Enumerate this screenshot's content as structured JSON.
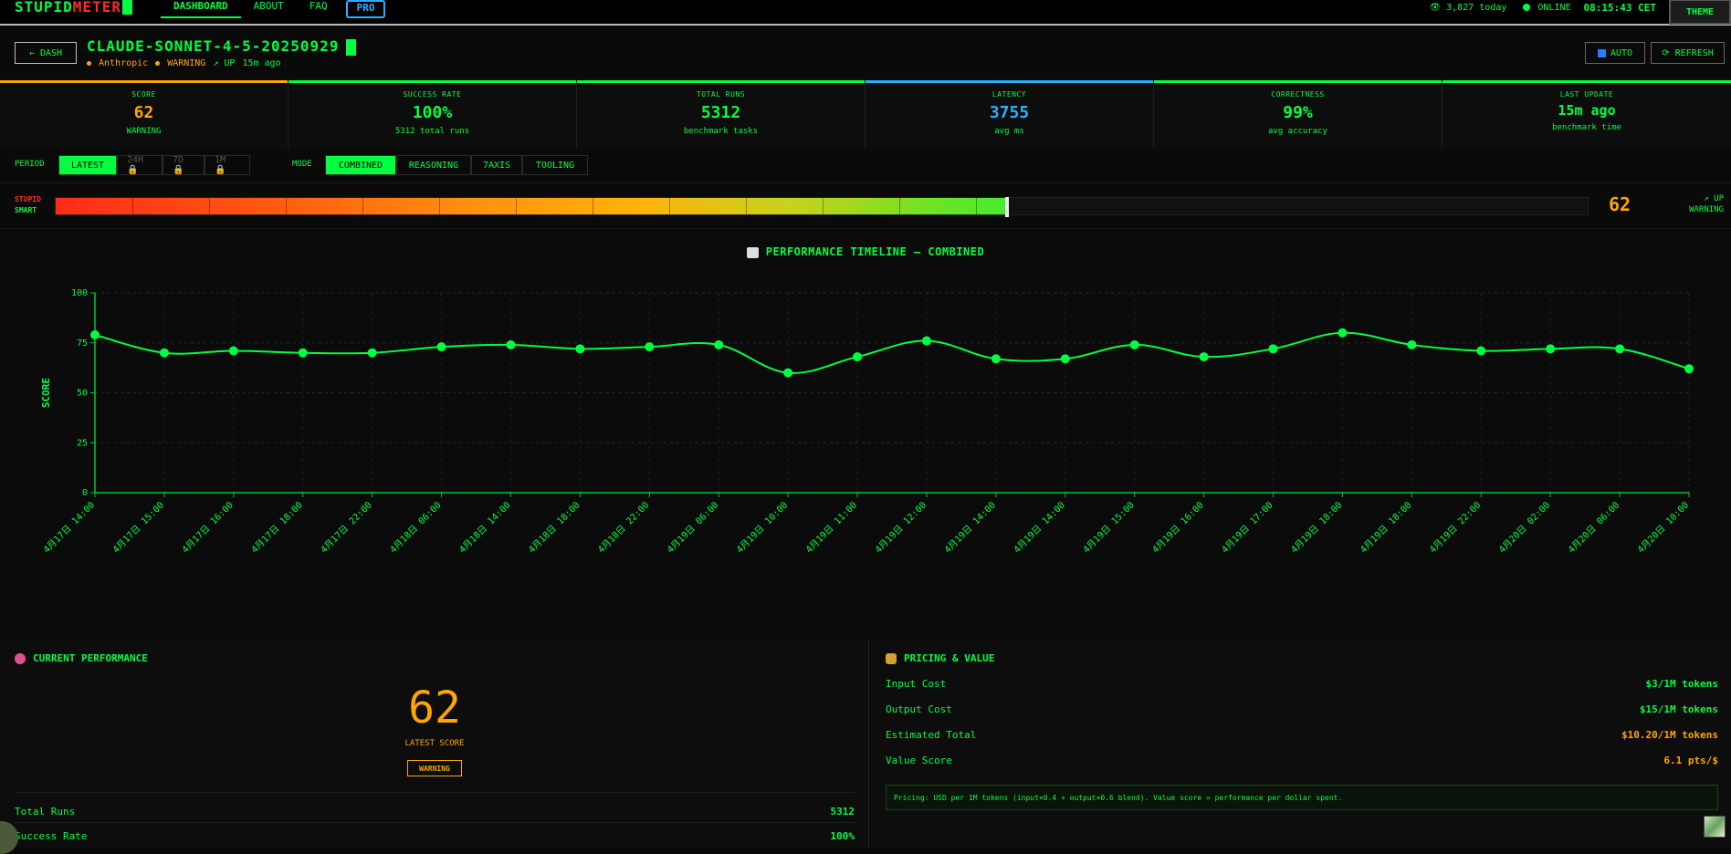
{
  "nav": {
    "logo_a": "STUPID",
    "logo_b": "METER",
    "links": [
      "DASHBOARD",
      "ABOUT",
      "FAQ"
    ],
    "pro": "PRO",
    "visitors": "3,827 today",
    "status": "ONLINE",
    "clock": "08:15:43 CET",
    "theme": "THEME"
  },
  "header": {
    "back": "← DASH",
    "model": "CLAUDE-SONNET-4-5-20250929",
    "provider": "Anthropic",
    "status": "WARNING",
    "trend": "↗ UP",
    "updated": "15m ago",
    "auto": "AUTO",
    "refresh": "⟳ REFRESH"
  },
  "stats": [
    {
      "label": "SCORE",
      "value": "62",
      "sub": "WARNING",
      "color": "#ffa500"
    },
    {
      "label": "SUCCESS RATE",
      "value": "100%",
      "sub": "5312 total runs",
      "color": "#00ff41"
    },
    {
      "label": "TOTAL RUNS",
      "value": "5312",
      "sub": "benchmark tasks",
      "color": "#00ff41"
    },
    {
      "label": "LATENCY",
      "value": "3755",
      "sub": "avg ms",
      "color": "#2ab0ff"
    },
    {
      "label": "CORRECTNESS",
      "value": "99%",
      "sub": "avg accuracy",
      "color": "#00ff41"
    },
    {
      "label": "LAST UPDATE",
      "value": "15m ago",
      "sub": "benchmark time",
      "color": "#00ff41"
    }
  ],
  "controls": {
    "period_label": "PERIOD",
    "periods": [
      "LATEST",
      "24H 🔒",
      "7D 🔒",
      "1M 🔒"
    ],
    "mode_label": "MODE",
    "modes": [
      "COMBINED",
      "REASONING",
      "7AXIS",
      "TOOLING"
    ]
  },
  "meter": {
    "label_low": "STUPID",
    "label_high": "SMART",
    "score": "62",
    "trend": "↗ UP",
    "status": "WARNING",
    "level": 0.62
  },
  "chart_title": "PERFORMANCE TIMELINE — COMBINED",
  "chart_data": {
    "type": "line",
    "ylabel": "SCORE",
    "ylim": [
      0,
      100
    ],
    "yticks": [
      0,
      25,
      50,
      75,
      100
    ],
    "grid": true,
    "categories": [
      "4月17日 14:00",
      "4月17日 15:00",
      "4月17日 16:00",
      "4月17日 18:00",
      "4月17日 22:00",
      "4月18日 06:00",
      "4月18日 14:00",
      "4月18日 18:00",
      "4月18日 22:00",
      "4月19日 06:00",
      "4月19日 10:00",
      "4月19日 11:00",
      "4月19日 12:00",
      "4月19日 14:00",
      "4月19日 14:00",
      "4月19日 15:00",
      "4月19日 16:00",
      "4月19日 17:00",
      "4月19日 18:00",
      "4月19日 18:00",
      "4月19日 22:00",
      "4月20日 02:00",
      "4月20日 06:00",
      "4月20日 10:00"
    ],
    "values": [
      79,
      70,
      71,
      70,
      70,
      73,
      74,
      72,
      73,
      74,
      60,
      68,
      76,
      67,
      67,
      74,
      68,
      72,
      80,
      74,
      71,
      72,
      72,
      62
    ],
    "color": "#00ff41"
  },
  "current": {
    "title": "CURRENT PERFORMANCE",
    "score": "62",
    "score_label": "LATEST SCORE",
    "badge": "WARNING",
    "rows": [
      {
        "label": "Total Runs",
        "value": "5312"
      },
      {
        "label": "Success Rate",
        "value": "100%"
      }
    ]
  },
  "pricing": {
    "title": "PRICING & VALUE",
    "rows": [
      {
        "label": "Input Cost",
        "value": "$3/1M tokens",
        "orange": false
      },
      {
        "label": "Output Cost",
        "value": "$15/1M tokens",
        "orange": false
      },
      {
        "label": "Estimated Total",
        "value": "$10.20/1M tokens",
        "orange": true
      },
      {
        "label": "Value Score",
        "value": "6.1 pts/$",
        "orange": true
      }
    ],
    "note": "Pricing: USD per 1M tokens (input×0.4 + output×0.6 blend). Value score = performance per dollar spent."
  }
}
